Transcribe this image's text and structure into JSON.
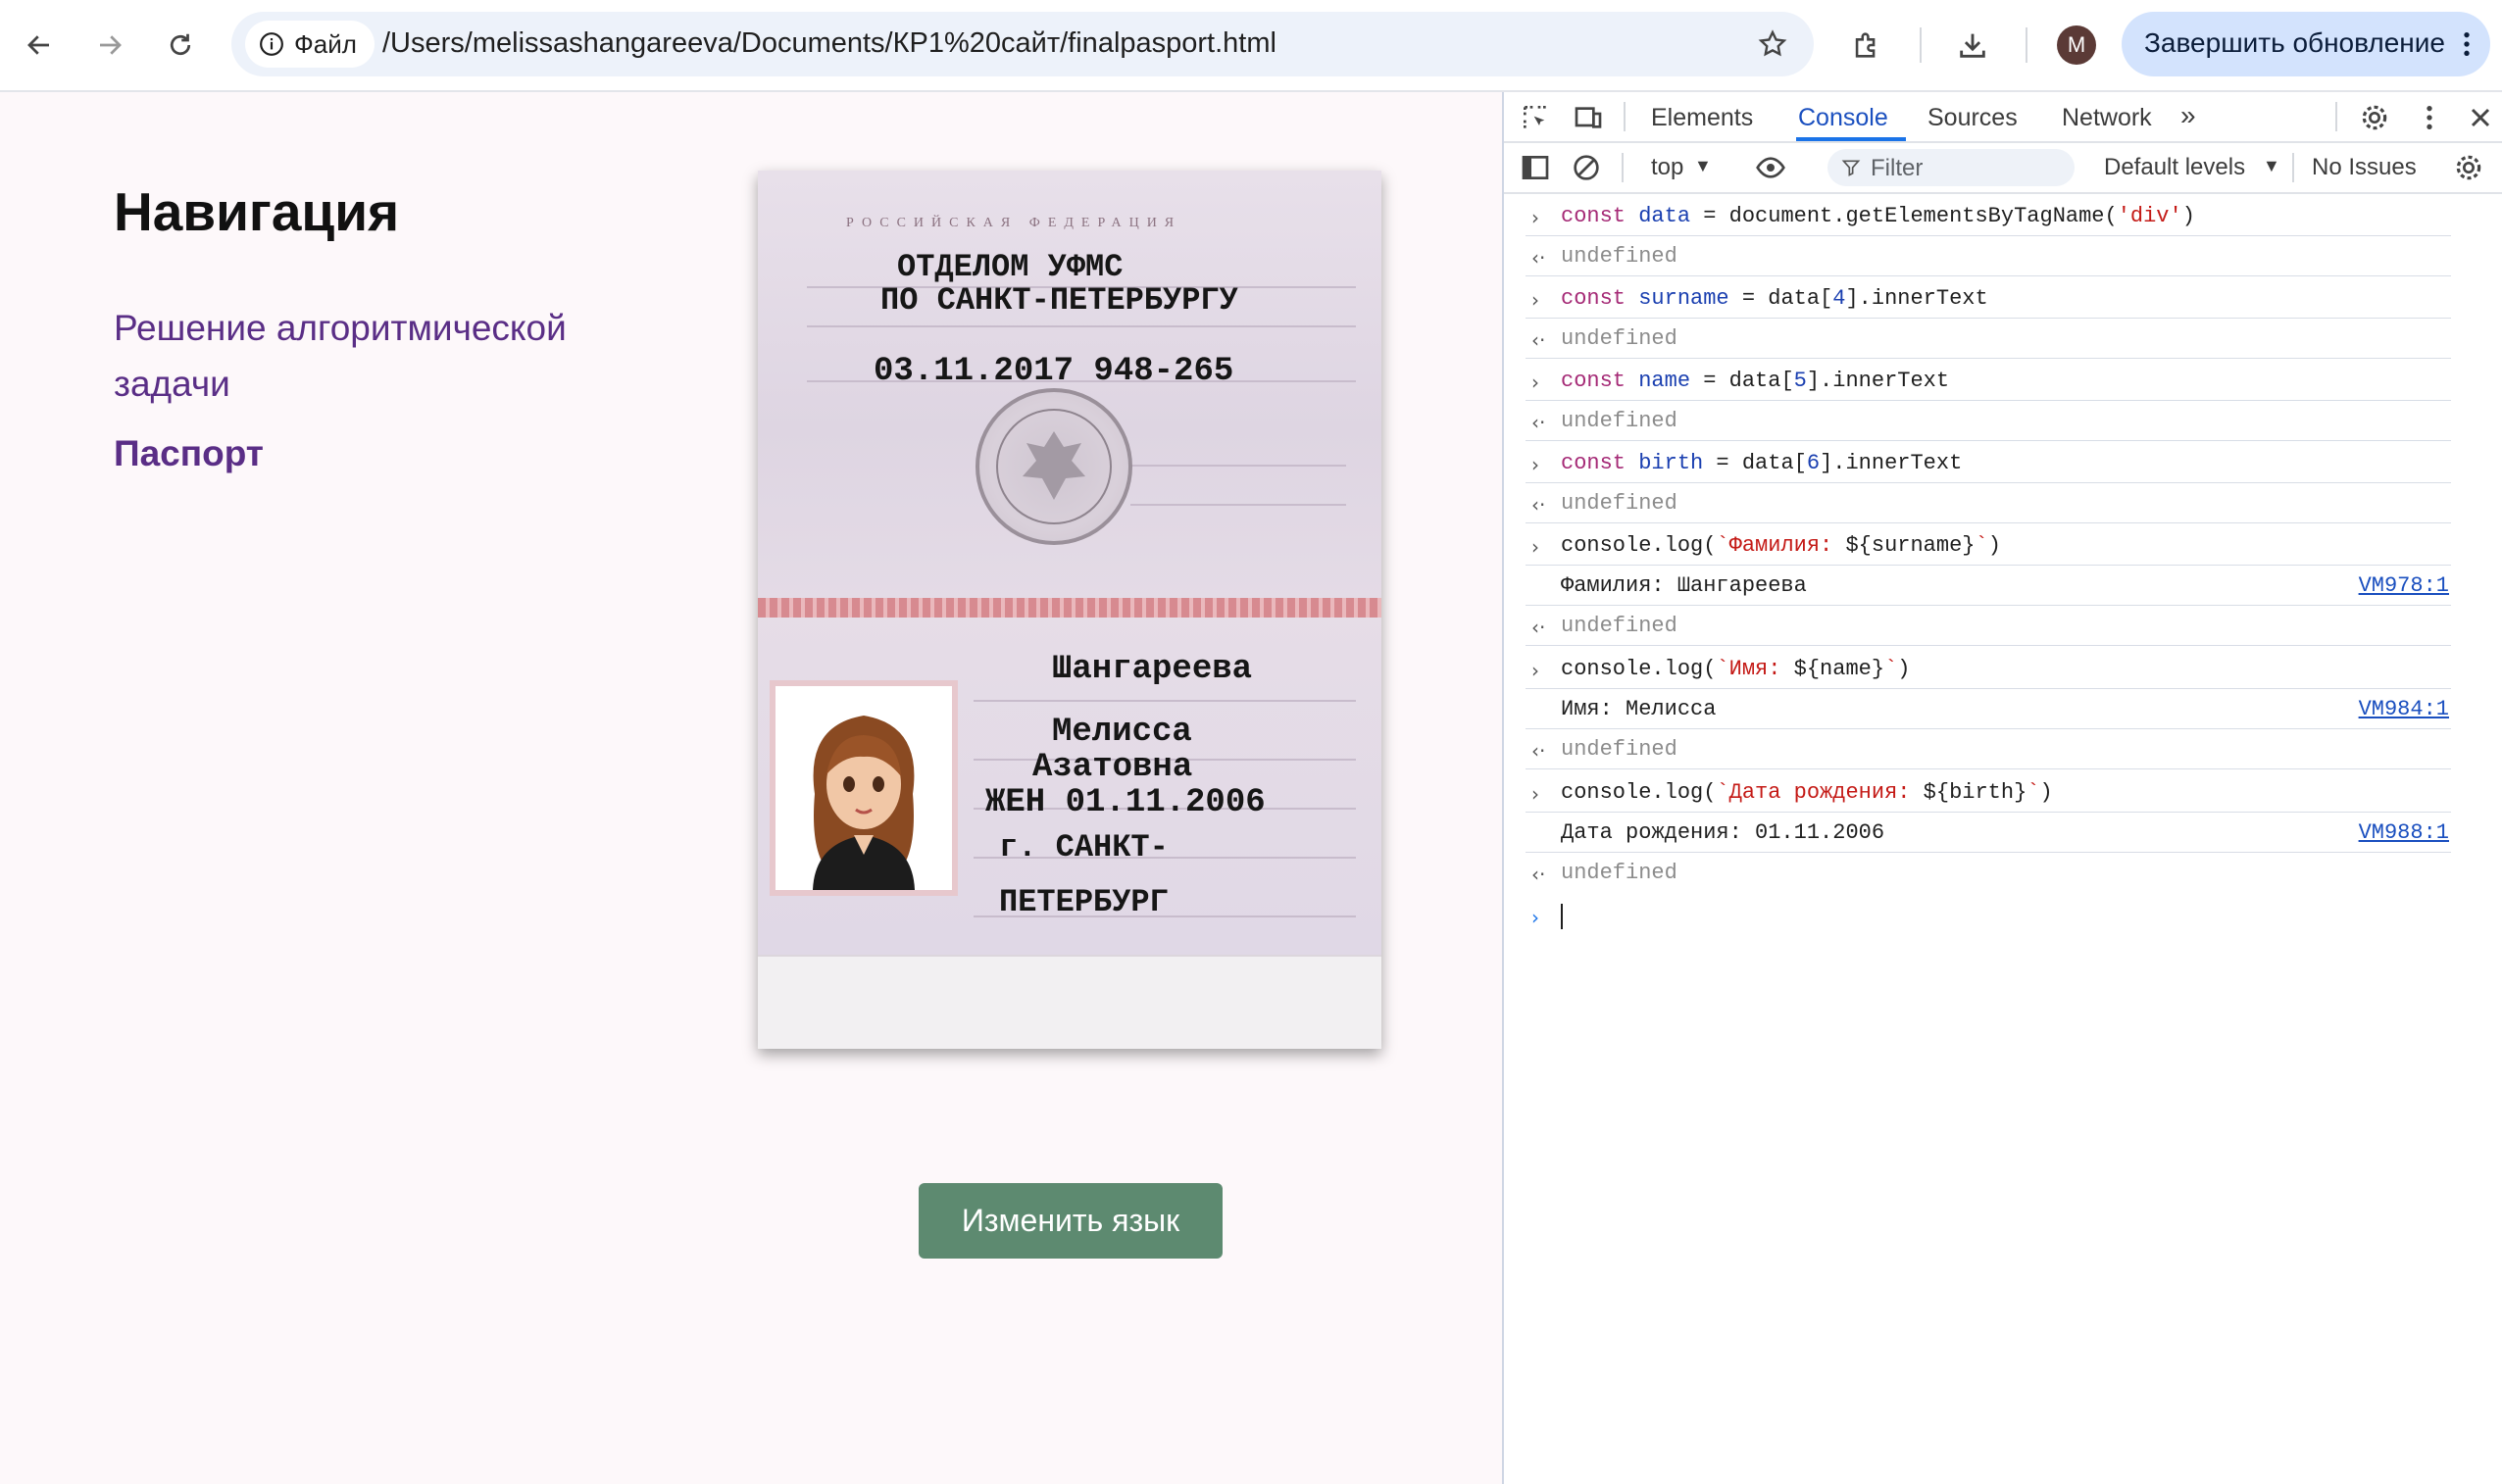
{
  "browser": {
    "file_chip": "Файл",
    "url": "/Users/melissashangareeva/Documents/КР1%20сайт/finalpasport.html",
    "update_button": "Завершить обновление",
    "avatar_letter": "M"
  },
  "page": {
    "nav_title": "Навигация",
    "nav_links": [
      "Решение алгоритмической задачи",
      "Паспорт"
    ],
    "button": "Изменить язык",
    "passport": {
      "header": "РОССИЙСКАЯ ФЕДЕРАЦИЯ",
      "issuer_line1": "ОТДЕЛОМ УФМС",
      "issuer_line2": "ПО САНКТ-ПЕТЕРБУРГУ",
      "issue_date_code": "03.11.2017  948-265",
      "surname": "Шангареева",
      "name": "Мелисса",
      "patronymic": "Азатовна",
      "sex_birth": "ЖЕН  01.11.2006",
      "birthplace_line1": "г. САНКТ-",
      "birthplace_line2": "ПЕТЕРБУРГ"
    }
  },
  "devtools": {
    "tabs": [
      "Elements",
      "Console",
      "Sources",
      "Network"
    ],
    "active_tab": "Console",
    "context": "top",
    "filter_placeholder": "Filter",
    "levels": "Default levels",
    "issues": "No Issues",
    "console": {
      "undefined": "undefined",
      "cmd1": {
        "kw": "const",
        "var": "data",
        "rest": " = document.getElementsByTagName(",
        "str": "'div'",
        "end": ")"
      },
      "cmd2": {
        "kw": "const",
        "var": "surname",
        "pre": " = data[",
        "num": "4",
        "end": "].innerText"
      },
      "cmd3": {
        "kw": "const",
        "var": "name",
        "pre": " = data[",
        "num": "5",
        "end": "].innerText"
      },
      "cmd4": {
        "kw": "const",
        "var": "birth",
        "pre": " = data[",
        "num": "6",
        "end": "].innerText"
      },
      "log1": {
        "pre": "console.log(",
        "str": "`Фамилия: ",
        "mid": "${surname}",
        "str_end": "`",
        "end": ")"
      },
      "out1": "Фамилия: Шангареева",
      "vm1": "VM978:1",
      "log2": {
        "pre": "console.log(",
        "str": "`Имя: ",
        "mid": "${name}",
        "str_end": "`",
        "end": ")"
      },
      "out2": "Имя: Мелисса",
      "vm2": "VM984:1",
      "log3": {
        "pre": "console.log(",
        "str": "`Дата рождения: ",
        "mid": "${birth}",
        "str_end": "`",
        "end": ")"
      },
      "out3": "Дата рождения: 01.11.2006",
      "vm3": "VM988:1"
    }
  }
}
